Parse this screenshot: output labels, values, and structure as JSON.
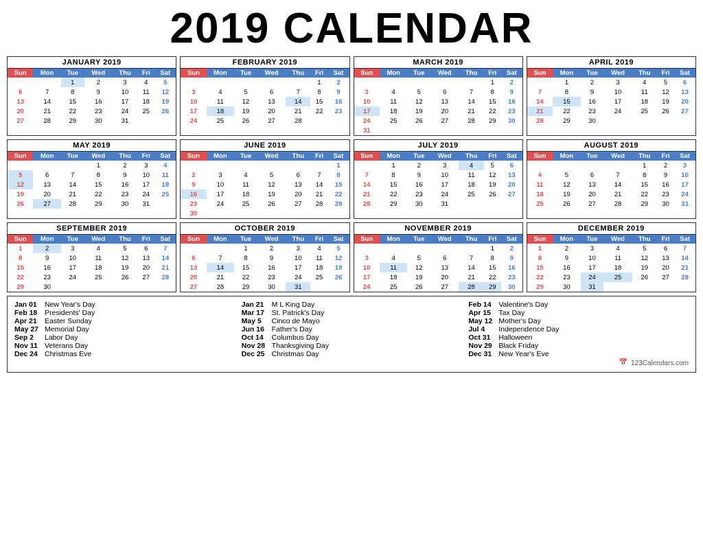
{
  "title": "2019 CALENDAR",
  "months": [
    {
      "name": "JANUARY 2019",
      "weeks": [
        [
          null,
          null,
          1,
          2,
          3,
          4,
          5
        ],
        [
          6,
          7,
          8,
          9,
          10,
          11,
          12
        ],
        [
          13,
          14,
          15,
          16,
          17,
          18,
          19
        ],
        [
          20,
          21,
          22,
          23,
          24,
          25,
          26
        ],
        [
          27,
          28,
          29,
          30,
          31,
          null,
          null
        ]
      ],
      "holidays": [
        1
      ]
    },
    {
      "name": "FEBRUARY 2019",
      "weeks": [
        [
          null,
          null,
          null,
          null,
          null,
          1,
          2
        ],
        [
          3,
          4,
          5,
          6,
          7,
          8,
          9
        ],
        [
          10,
          11,
          12,
          13,
          14,
          15,
          16
        ],
        [
          17,
          18,
          19,
          20,
          21,
          22,
          23
        ],
        [
          24,
          25,
          26,
          27,
          28,
          null,
          null
        ]
      ],
      "holidays": [
        14,
        18
      ]
    },
    {
      "name": "MARCH 2019",
      "weeks": [
        [
          null,
          null,
          null,
          null,
          null,
          1,
          2
        ],
        [
          3,
          4,
          5,
          6,
          7,
          8,
          9
        ],
        [
          10,
          11,
          12,
          13,
          14,
          15,
          16
        ],
        [
          17,
          18,
          19,
          20,
          21,
          22,
          23
        ],
        [
          24,
          25,
          26,
          27,
          28,
          29,
          30
        ],
        [
          31,
          null,
          null,
          null,
          null,
          null,
          null
        ]
      ],
      "holidays": [
        17
      ]
    },
    {
      "name": "APRIL 2019",
      "weeks": [
        [
          null,
          1,
          2,
          3,
          4,
          5,
          6
        ],
        [
          7,
          8,
          9,
          10,
          11,
          12,
          13
        ],
        [
          14,
          15,
          16,
          17,
          18,
          19,
          20
        ],
        [
          21,
          22,
          23,
          24,
          25,
          26,
          27
        ],
        [
          28,
          29,
          30,
          null,
          null,
          null,
          null
        ]
      ],
      "holidays": [
        15,
        21
      ]
    },
    {
      "name": "MAY 2019",
      "weeks": [
        [
          null,
          null,
          null,
          1,
          2,
          3,
          4
        ],
        [
          5,
          6,
          7,
          8,
          9,
          10,
          11
        ],
        [
          12,
          13,
          14,
          15,
          16,
          17,
          18
        ],
        [
          19,
          20,
          21,
          22,
          23,
          24,
          25
        ],
        [
          26,
          27,
          28,
          29,
          30,
          31,
          null
        ]
      ],
      "holidays": [
        5,
        12,
        27
      ]
    },
    {
      "name": "JUNE 2019",
      "weeks": [
        [
          null,
          null,
          null,
          null,
          null,
          null,
          1
        ],
        [
          2,
          3,
          4,
          5,
          6,
          7,
          8
        ],
        [
          9,
          10,
          11,
          12,
          13,
          14,
          15
        ],
        [
          16,
          17,
          18,
          19,
          20,
          21,
          22
        ],
        [
          23,
          24,
          25,
          26,
          27,
          28,
          29
        ],
        [
          30,
          null,
          null,
          null,
          null,
          null,
          null
        ]
      ],
      "holidays": [
        16
      ]
    },
    {
      "name": "JULY 2019",
      "weeks": [
        [
          null,
          1,
          2,
          3,
          4,
          5,
          6
        ],
        [
          7,
          8,
          9,
          10,
          11,
          12,
          13
        ],
        [
          14,
          15,
          16,
          17,
          18,
          19,
          20
        ],
        [
          21,
          22,
          23,
          24,
          25,
          26,
          27
        ],
        [
          28,
          29,
          30,
          31,
          null,
          null,
          null
        ]
      ],
      "holidays": [
        4
      ]
    },
    {
      "name": "AUGUST 2019",
      "weeks": [
        [
          null,
          null,
          null,
          null,
          1,
          2,
          3
        ],
        [
          4,
          5,
          6,
          7,
          8,
          9,
          10
        ],
        [
          11,
          12,
          13,
          14,
          15,
          16,
          17
        ],
        [
          18,
          19,
          20,
          21,
          22,
          23,
          24
        ],
        [
          25,
          26,
          27,
          28,
          29,
          30,
          31
        ]
      ],
      "holidays": []
    },
    {
      "name": "SEPTEMBER 2019",
      "weeks": [
        [
          1,
          2,
          3,
          4,
          5,
          6,
          7
        ],
        [
          8,
          9,
          10,
          11,
          12,
          13,
          14
        ],
        [
          15,
          16,
          17,
          18,
          19,
          20,
          21
        ],
        [
          22,
          23,
          24,
          25,
          26,
          27,
          28
        ],
        [
          29,
          30,
          null,
          null,
          null,
          null,
          null
        ]
      ],
      "holidays": [
        2
      ]
    },
    {
      "name": "OCTOBER 2019",
      "weeks": [
        [
          null,
          null,
          1,
          2,
          3,
          4,
          5
        ],
        [
          6,
          7,
          8,
          9,
          10,
          11,
          12
        ],
        [
          13,
          14,
          15,
          16,
          17,
          18,
          19
        ],
        [
          20,
          21,
          22,
          23,
          24,
          25,
          26
        ],
        [
          27,
          28,
          29,
          30,
          31,
          null,
          null
        ]
      ],
      "holidays": [
        14,
        31
      ]
    },
    {
      "name": "NOVEMBER 2019",
      "weeks": [
        [
          null,
          null,
          null,
          null,
          null,
          1,
          2
        ],
        [
          3,
          4,
          5,
          6,
          7,
          8,
          9
        ],
        [
          10,
          11,
          12,
          13,
          14,
          15,
          16
        ],
        [
          17,
          18,
          19,
          20,
          21,
          22,
          23
        ],
        [
          24,
          25,
          26,
          27,
          28,
          29,
          30
        ]
      ],
      "holidays": [
        11,
        28,
        29
      ]
    },
    {
      "name": "DECEMBER 2019",
      "weeks": [
        [
          1,
          2,
          3,
          4,
          5,
          6,
          7
        ],
        [
          8,
          9,
          10,
          11,
          12,
          13,
          14
        ],
        [
          15,
          16,
          17,
          18,
          19,
          20,
          21
        ],
        [
          22,
          23,
          24,
          25,
          26,
          27,
          28
        ],
        [
          29,
          30,
          31,
          null,
          null,
          null,
          null
        ]
      ],
      "holidays": [
        24,
        25,
        31
      ]
    }
  ],
  "days_header": [
    "Sun",
    "Mon",
    "Tue",
    "Wed",
    "Thu",
    "Fri",
    "Sat"
  ],
  "holidays_col1": [
    {
      "date": "Jan 01",
      "name": "New Year's Day"
    },
    {
      "date": "Feb 18",
      "name": "Presidents' Day"
    },
    {
      "date": "Apr 21",
      "name": "Easter Sunday"
    },
    {
      "date": "May 27",
      "name": "Memorial Day"
    },
    {
      "date": "Sep 2",
      "name": "Labor Day"
    },
    {
      "date": "Nov 11",
      "name": "Veterans Day"
    },
    {
      "date": "Dec 24",
      "name": "Christmas Eve"
    }
  ],
  "holidays_col2": [
    {
      "date": "Jan 21",
      "name": "M L King Day"
    },
    {
      "date": "Mar 17",
      "name": "St. Patrick's Day"
    },
    {
      "date": "May 5",
      "name": "Cinco de Mayo"
    },
    {
      "date": "Jun 16",
      "name": "Father's Day"
    },
    {
      "date": "Oct 14",
      "name": "Columbus Day"
    },
    {
      "date": "Nov 28",
      "name": "Thanksgiving Day"
    },
    {
      "date": "Dec 25",
      "name": "Christmas Day"
    }
  ],
  "holidays_col3": [
    {
      "date": "Feb 14",
      "name": "Valentine's Day"
    },
    {
      "date": "Apr 15",
      "name": "Tax Day"
    },
    {
      "date": "May 12",
      "name": "Mother's Day"
    },
    {
      "date": "Jul 4",
      "name": "Independence Day"
    },
    {
      "date": "Oct 31",
      "name": "Halloween"
    },
    {
      "date": "Nov 29",
      "name": "Black Friday"
    },
    {
      "date": "Dec 31",
      "name": "New Year's Eve"
    }
  ],
  "brand": "123Calendars.com"
}
